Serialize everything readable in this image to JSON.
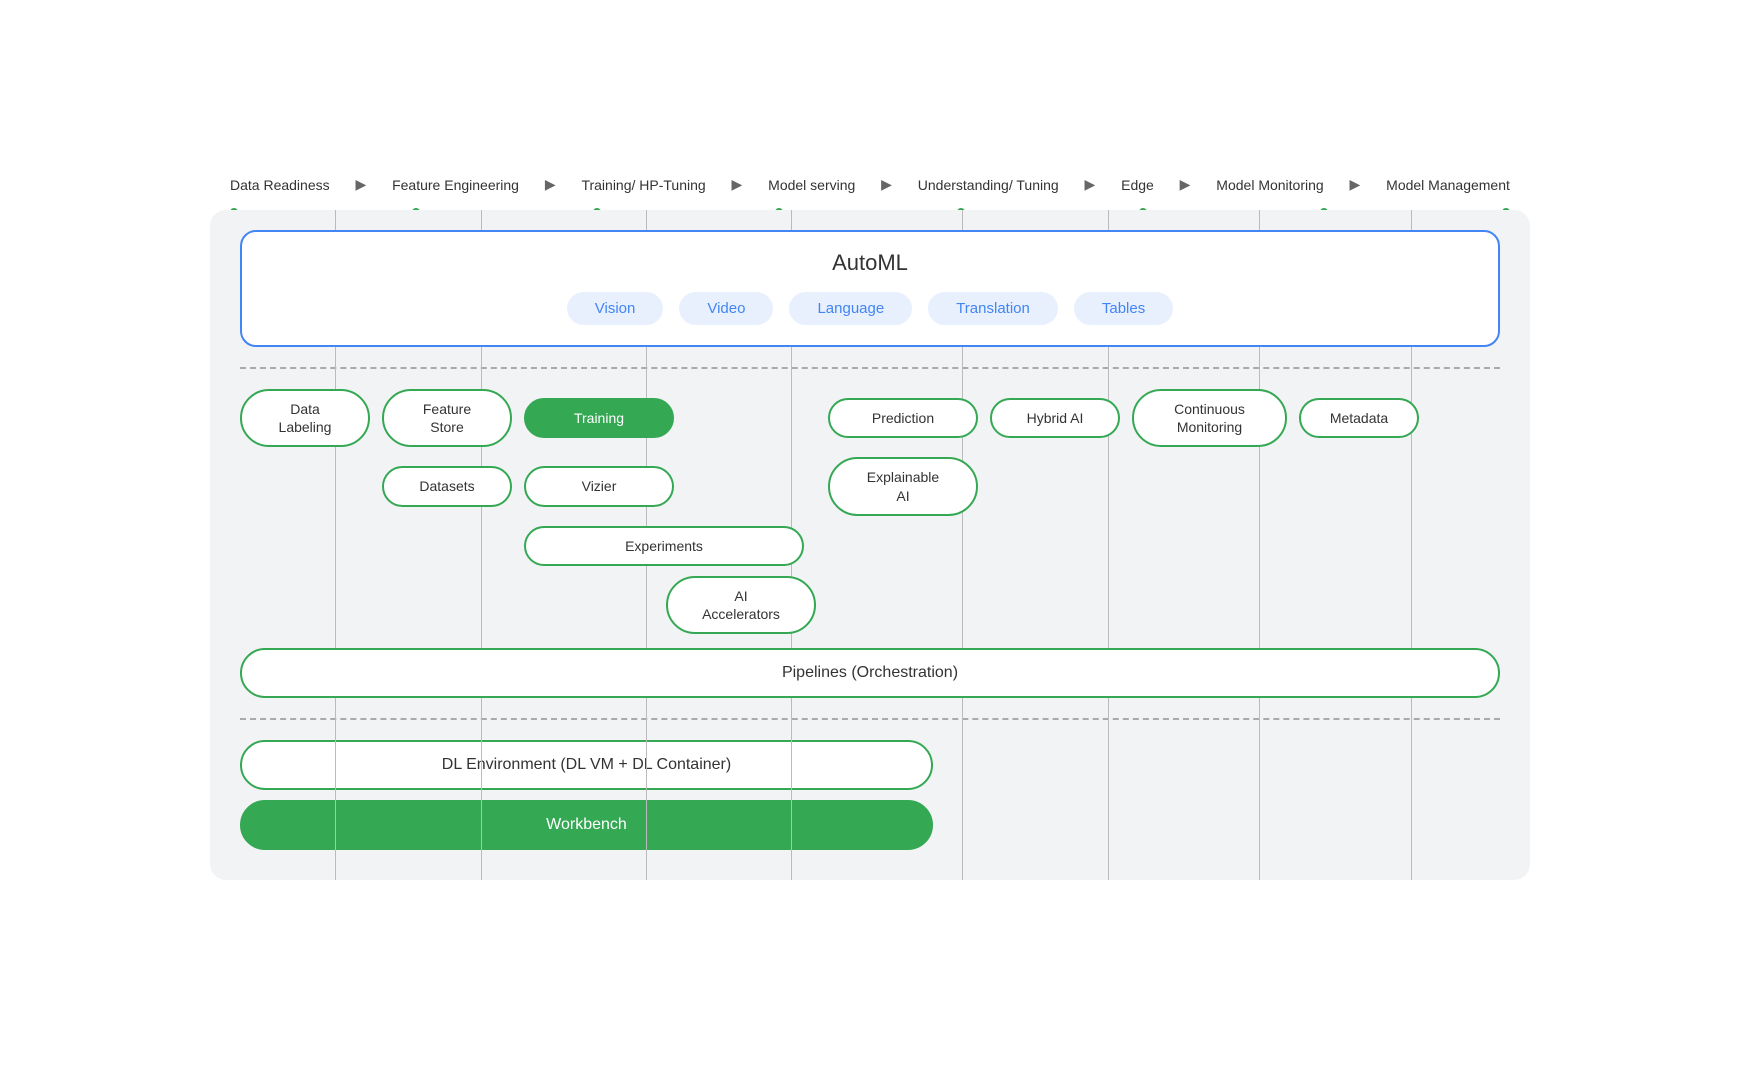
{
  "pipeline": {
    "steps": [
      {
        "label": "Data\nReadiness"
      },
      {
        "label": "Feature\nEngineering"
      },
      {
        "label": "Training/\nHP-Tuning"
      },
      {
        "label": "Model\nserving"
      },
      {
        "label": "Understanding/\nTuning"
      },
      {
        "label": "Edge"
      },
      {
        "label": "Model\nMonitoring"
      },
      {
        "label": "Model\nManagement"
      }
    ]
  },
  "automl": {
    "title": "AutoML",
    "pills": [
      "Vision",
      "Video",
      "Language",
      "Translation",
      "Tables"
    ]
  },
  "components": {
    "row1": [
      {
        "label": "Data\nLabeling",
        "filled": false
      },
      {
        "label": "Feature\nStore",
        "filled": false
      },
      {
        "label": "Training",
        "filled": true
      },
      {
        "label": "",
        "filled": false,
        "empty": true
      },
      {
        "label": "Prediction",
        "filled": false
      },
      {
        "label": "Hybrid AI",
        "filled": false
      },
      {
        "label": "Continuous\nMonitoring",
        "filled": false
      },
      {
        "label": "Metadata",
        "filled": false
      }
    ],
    "row2": [
      {
        "label": "Datasets",
        "filled": false,
        "col": 1
      },
      {
        "label": "Vizier",
        "filled": false,
        "col": 2
      },
      {
        "label": "Explainable\nAI",
        "filled": false,
        "col": 4
      }
    ],
    "row3": [
      {
        "label": "Experiments",
        "filled": false,
        "col": 2
      }
    ],
    "row4": [
      {
        "label": "AI\nAccelerators",
        "filled": false,
        "col": 2
      }
    ],
    "pipelines": "Pipelines (Orchestration)",
    "dl_env": "DL Environment (DL VM + DL Container)",
    "workbench": "Workbench"
  },
  "vlines": [
    {
      "left_pct": 9.8
    },
    {
      "left_pct": 20.5
    },
    {
      "left_pct": 33.0
    },
    {
      "left_pct": 44.0
    },
    {
      "left_pct": 56.5
    },
    {
      "left_pct": 67.0
    },
    {
      "left_pct": 78.5
    },
    {
      "left_pct": 90.0
    }
  ]
}
